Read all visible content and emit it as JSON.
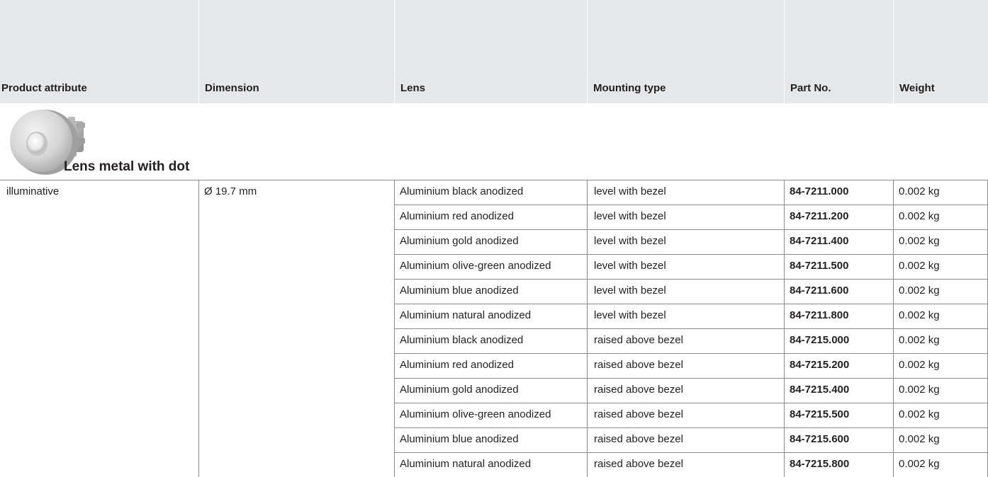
{
  "table": {
    "columns": [
      "Product attribute",
      "Dimension",
      "Lens",
      "Mounting type",
      "Part No.",
      "Weight"
    ],
    "group_title": "Lens metal with dot",
    "product_attribute": "illuminative",
    "dimension": "Ø 19.7 mm",
    "rows": [
      {
        "lens": "Aluminium black anodized",
        "mounting": "level with bezel",
        "part_no": "84-7211.000",
        "weight": "0.002 kg"
      },
      {
        "lens": "Aluminium red anodized",
        "mounting": "level with bezel",
        "part_no": "84-7211.200",
        "weight": "0.002 kg"
      },
      {
        "lens": "Aluminium gold anodized",
        "mounting": "level with bezel",
        "part_no": "84-7211.400",
        "weight": "0.002 kg"
      },
      {
        "lens": "Aluminium olive-green anodized",
        "mounting": "level with bezel",
        "part_no": "84-7211.500",
        "weight": "0.002 kg"
      },
      {
        "lens": "Aluminium blue anodized",
        "mounting": "level with bezel",
        "part_no": "84-7211.600",
        "weight": "0.002 kg"
      },
      {
        "lens": "Aluminium natural anodized",
        "mounting": "level with bezel",
        "part_no": "84-7211.800",
        "weight": "0.002 kg"
      },
      {
        "lens": "Aluminium black anodized",
        "mounting": "raised above bezel",
        "part_no": "84-7215.000",
        "weight": "0.002 kg"
      },
      {
        "lens": "Aluminium red anodized",
        "mounting": "raised above bezel",
        "part_no": "84-7215.200",
        "weight": "0.002 kg"
      },
      {
        "lens": "Aluminium gold anodized",
        "mounting": "raised above bezel",
        "part_no": "84-7215.400",
        "weight": "0.002 kg"
      },
      {
        "lens": "Aluminium olive-green anodized",
        "mounting": "raised above bezel",
        "part_no": "84-7215.500",
        "weight": "0.002 kg"
      },
      {
        "lens": "Aluminium blue anodized",
        "mounting": "raised above bezel",
        "part_no": "84-7215.600",
        "weight": "0.002 kg"
      },
      {
        "lens": "Aluminium natural anodized",
        "mounting": "raised above bezel",
        "part_no": "84-7215.800",
        "weight": "0.002 kg"
      }
    ]
  },
  "colors": {
    "header_bg": "#e6e7e8",
    "grid_line": "#8b8b8b",
    "text": "#231f20"
  },
  "icons": {
    "product_image": "round-metal-lens-button-icon"
  }
}
